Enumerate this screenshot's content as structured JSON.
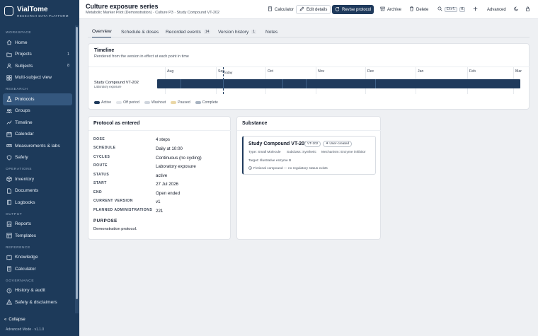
{
  "app": {
    "name": "VialTome",
    "tagline": "RESEARCH DATA PLATFORM",
    "mode": "Advanced Mode · v1.1.0",
    "collapse_label": "Collapse"
  },
  "sidebar": {
    "sections": {
      "workspace": "WORKSPACE",
      "research": "RESEARCH",
      "operations": "OPERATIONS",
      "output": "OUTPUT",
      "reference": "REFERENCE",
      "governance": "GOVERNANCE"
    },
    "workspace": [
      {
        "label": "Home",
        "icon": "home-icon"
      },
      {
        "label": "Projects",
        "icon": "folder-icon",
        "count": "1"
      },
      {
        "label": "Subjects",
        "icon": "users-icon",
        "count": "8"
      },
      {
        "label": "Multi-subject view",
        "icon": "grid-icon"
      }
    ],
    "research": [
      {
        "label": "Protocols",
        "icon": "flask-icon"
      },
      {
        "label": "Groups",
        "icon": "group-icon"
      },
      {
        "label": "Timeline",
        "icon": "timeline-icon"
      },
      {
        "label": "Calendar",
        "icon": "calendar-icon"
      },
      {
        "label": "Measurements & labs",
        "icon": "ruler-icon"
      },
      {
        "label": "Safety",
        "icon": "shield-icon"
      }
    ],
    "operations": [
      {
        "label": "Inventory",
        "icon": "box-icon"
      },
      {
        "label": "Documents",
        "icon": "document-icon"
      },
      {
        "label": "Logbooks",
        "icon": "book-icon"
      }
    ],
    "output": [
      {
        "label": "Reports",
        "icon": "report-icon"
      },
      {
        "label": "Templates",
        "icon": "template-icon"
      }
    ],
    "reference": [
      {
        "label": "Knowledge",
        "icon": "knowledge-icon"
      },
      {
        "label": "Calculator",
        "icon": "calculator-icon"
      }
    ],
    "governance": [
      {
        "label": "History & audit",
        "icon": "history-icon"
      },
      {
        "label": "Safety & disclaimers",
        "icon": "warning-icon"
      }
    ]
  },
  "header": {
    "title": "Culture exposure series",
    "subtitle": "Metabolic Marker Pilot (Demonstration) · Culture P3 · Study Compound VT-202",
    "calculator_label": "Calculator",
    "edit_label": "Edit details",
    "revise_label": "Revise protocol",
    "archive_label": "Archive",
    "delete_label": "Delete",
    "search_kbd_ctrl": "Ctrl",
    "search_kbd_k": "K",
    "advanced_label": "Advanced"
  },
  "tabs": [
    {
      "label": "Overview"
    },
    {
      "label": "Schedule & doses"
    },
    {
      "label": "Recorded events",
      "badge": "14"
    },
    {
      "label": "Version history",
      "badge": "1"
    },
    {
      "label": "Notes"
    }
  ],
  "timeline": {
    "title": "Timeline",
    "subtitle": "Rendered from the version in effect at each point in time",
    "months": [
      "Aug",
      "Sep",
      "Oct",
      "Nov",
      "Dec",
      "Jan",
      "Feb",
      "Mar"
    ],
    "today_label": "today",
    "row_label": "Study Compound VT-202",
    "row_sublabel": "Laboratory exposure",
    "legend": [
      {
        "label": "Active",
        "color": "#1f3a5c"
      },
      {
        "label": "Off period",
        "color": "#e3e6ea"
      },
      {
        "label": "Washout",
        "color": "#cfd5dd"
      },
      {
        "label": "Paused",
        "color": "#ead7a6"
      },
      {
        "label": "Complete",
        "color": "#a7b3c1"
      }
    ]
  },
  "protocol": {
    "title": "Protocol as entered",
    "fields": [
      {
        "label": "DOSE",
        "value": "4 steps"
      },
      {
        "label": "SCHEDULE",
        "value": "Daily at 10:00"
      },
      {
        "label": "CYCLES",
        "value": "Continuous (no cycling)"
      },
      {
        "label": "ROUTE",
        "value": "Laboratory exposure"
      },
      {
        "label": "STATUS",
        "value": "active"
      },
      {
        "label": "START",
        "value": "27 Jul 2026"
      },
      {
        "label": "END",
        "value": "Open ended"
      },
      {
        "label": "CURRENT VERSION",
        "value": "v1"
      },
      {
        "label": "PLANNED ADMINISTRATIONS",
        "value": "221"
      }
    ],
    "purpose_label": "PURPOSE",
    "purpose_text": "Demonstration protocol."
  },
  "substance": {
    "title": "Substance",
    "name": "Study Compound VT-202",
    "code_chip": "VT-202",
    "origin_chip": "User-created",
    "type": "Type: Small Molecule",
    "subclass": "Subclass: Synthetic",
    "mechanism": "Mechanism: Enzyme inhibitor",
    "target": "Target: Illustrative enzyme B",
    "note": "Fictional compound — no regulatory status exists"
  },
  "colors": {
    "sidebar": "#1d3a5a",
    "accent": "#1f3a5c"
  }
}
